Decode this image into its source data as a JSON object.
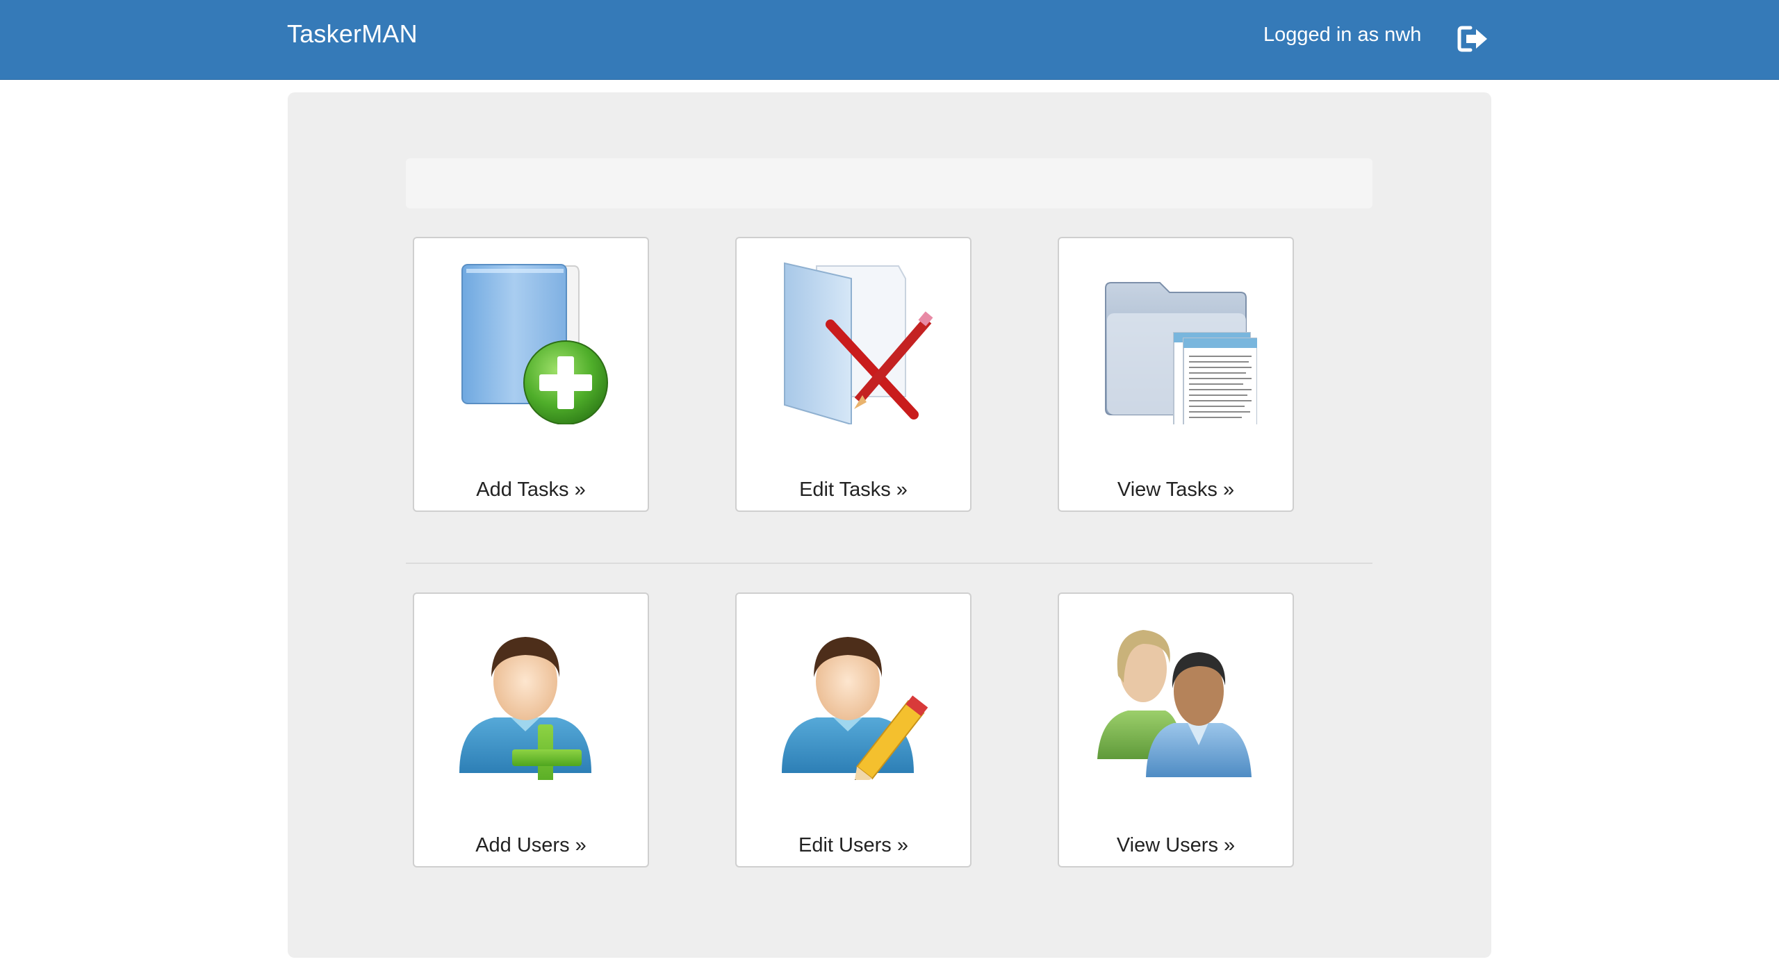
{
  "navbar": {
    "brand": "TaskerMAN",
    "logged_in_text": "Logged in as nwh",
    "logout_icon": "sign-out-icon"
  },
  "colors": {
    "navbar_bg": "#357ab8",
    "panel_bg": "#eeeeee",
    "tile_border": "#cfcfcf"
  },
  "tiles": {
    "task_row": [
      {
        "label": "Add Tasks »",
        "icon": "folder-add-icon"
      },
      {
        "label": "Edit Tasks »",
        "icon": "folder-edit-icon"
      },
      {
        "label": "View Tasks »",
        "icon": "folder-view-icon"
      }
    ],
    "user_row": [
      {
        "label": "Add Users »",
        "icon": "user-add-icon"
      },
      {
        "label": "Edit Users »",
        "icon": "user-edit-icon"
      },
      {
        "label": "View Users »",
        "icon": "users-group-icon"
      }
    ]
  }
}
